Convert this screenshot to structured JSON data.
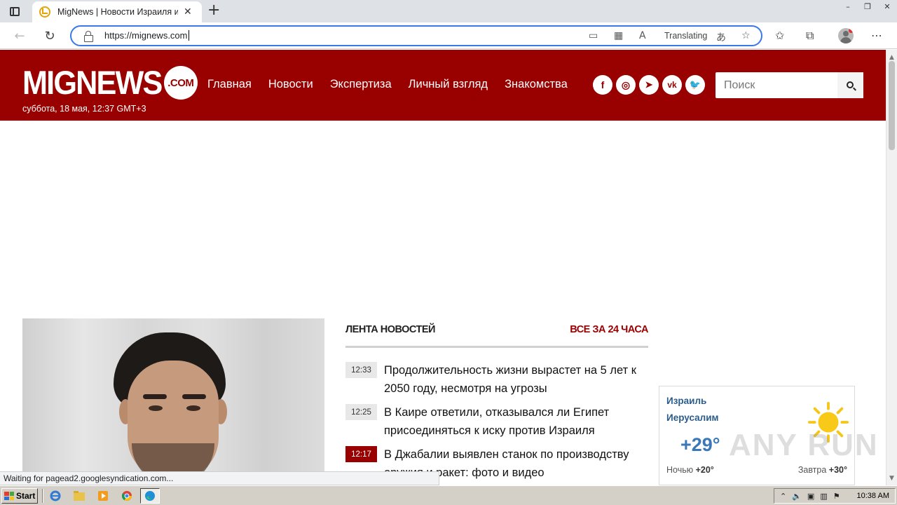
{
  "browser": {
    "tab_title": "MigNews | Новости Израиля и Мира",
    "tab_close": "✕",
    "new_tab": "+",
    "window_controls": [
      "–",
      "❐",
      "✕"
    ],
    "url": "https://mignews.com",
    "translating_label": "Translating",
    "status_text": "Waiting for pagead2.googlesyndication.com..."
  },
  "site": {
    "logo_text": "MIGNEWS",
    "logo_com": ".COM",
    "date_line": "суббота, 18 мая, 12:37 GMT+3",
    "nav": [
      "Главная",
      "Новости",
      "Экспертиза",
      "Личный взгляд",
      "Знакомства"
    ],
    "socials": [
      {
        "name": "facebook",
        "glyph": "f"
      },
      {
        "name": "instagram",
        "glyph": "◎"
      },
      {
        "name": "telegram",
        "glyph": "➤"
      },
      {
        "name": "vk",
        "glyph": "vk"
      },
      {
        "name": "twitter",
        "glyph": "🐦"
      }
    ],
    "search_placeholder": "Поиск"
  },
  "feed": {
    "title": "ЛЕНТА НОВОСТЕЙ",
    "all_link": "ВСЕ ЗА 24 ЧАСА",
    "items": [
      {
        "time": "12:33",
        "text": "Продолжительность жизни вырастет на 5 лет к 2050 году, несмотря на угрозы",
        "hot": false
      },
      {
        "time": "12:25",
        "text": "В Каире ответили, отказывался ли Египет присоединяться к иску против Израиля",
        "hot": false
      },
      {
        "time": "12:17",
        "text": "В Джабалии выявлен станок по производству оружия и ракет: фото и видео",
        "hot": true
      }
    ]
  },
  "weather": {
    "country": "Израиль",
    "city": "Иерусалим",
    "temp": "+29°",
    "night_label": "Ночью",
    "night_temp": "+20°",
    "tomorrow_label": "Завтра",
    "tomorrow_temp": "+30°"
  },
  "watermark": "ANY RUN",
  "taskbar": {
    "start_label": "Start",
    "clock": "10:38 AM"
  },
  "colors": {
    "brand": "#990000",
    "weather_blue": "#2b5d8c",
    "address_focus": "#3b78e7"
  }
}
